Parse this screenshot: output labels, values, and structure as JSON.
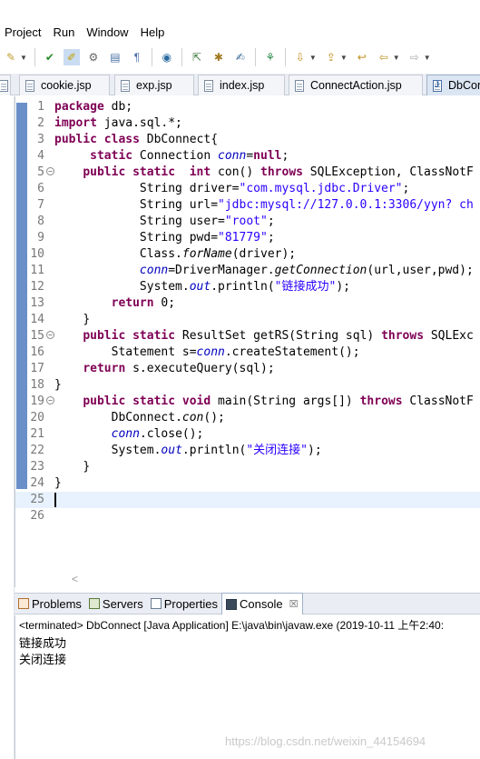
{
  "menu": [
    "Project",
    "Run",
    "Window",
    "Help"
  ],
  "toolbar_icons": [
    "pencil-icon",
    "skip-icon",
    "brush-icon",
    "gear-run-icon",
    "square-icon",
    "pilcrow-icon",
    "globe-icon",
    "task-icon",
    "puzzle-icon",
    "edit-icon",
    "git-icon",
    "down-arrow-icon",
    "wrench-icon",
    "back-icon",
    "back-arrow-icon",
    "forward-arrow-icon"
  ],
  "editor_tabs": [
    {
      "label": "cookie.jsp",
      "active": false
    },
    {
      "label": "exp.jsp",
      "active": false
    },
    {
      "label": "index.jsp",
      "active": false
    },
    {
      "label": "ConnectAction.jsp",
      "active": false
    },
    {
      "label": "DbCon",
      "active": true
    }
  ],
  "code_lines": [
    {
      "n": "1",
      "fold": false
    },
    {
      "n": "2",
      "fold": false
    },
    {
      "n": "3",
      "fold": false
    },
    {
      "n": "4",
      "fold": false
    },
    {
      "n": "5",
      "fold": true
    },
    {
      "n": "6",
      "fold": false
    },
    {
      "n": "7",
      "fold": false
    },
    {
      "n": "8",
      "fold": false
    },
    {
      "n": "9",
      "fold": false
    },
    {
      "n": "10",
      "fold": false
    },
    {
      "n": "11",
      "fold": false
    },
    {
      "n": "12",
      "fold": false
    },
    {
      "n": "13",
      "fold": false
    },
    {
      "n": "14",
      "fold": false
    },
    {
      "n": "15",
      "fold": true
    },
    {
      "n": "16",
      "fold": false
    },
    {
      "n": "17",
      "fold": false
    },
    {
      "n": "18",
      "fold": false
    },
    {
      "n": "19",
      "fold": true
    },
    {
      "n": "20",
      "fold": false
    },
    {
      "n": "21",
      "fold": false
    },
    {
      "n": "22",
      "fold": false
    },
    {
      "n": "23",
      "fold": false
    },
    {
      "n": "24",
      "fold": false
    },
    {
      "n": "25",
      "fold": false
    },
    {
      "n": "26",
      "fold": false
    }
  ],
  "code": {
    "l1_kw": "package",
    "l1_rest": " db;",
    "l2_kw": "import",
    "l2_rest": " java.sql.*;",
    "l3_kw1": "public",
    "l3_kw2": "class",
    "l3_rest": " DbConnect{",
    "l4_kw": "static",
    "l4_a": " Connection ",
    "l4_field": "conn",
    "l4_b": "=",
    "l4_kw2": "null",
    "l4_c": ";",
    "l5_kw1": "public",
    "l5_kw2": "static",
    "l5_kw3": "int",
    "l5_a": " con() ",
    "l5_kw4": "throws",
    "l5_b": " SQLException, ClassNotF",
    "l6_a": "String driver=",
    "l6_str": "\"com.mysql.jdbc.Driver\"",
    "l6_b": ";",
    "l7_a": "String url=",
    "l7_str": "\"jdbc:mysql://127.0.0.1:3306/yyn? ch",
    "l8_a": "String user=",
    "l8_str": "\"root\"",
    "l8_b": ";",
    "l9_a": "String pwd=",
    "l9_str": "\"81779\"",
    "l9_b": ";",
    "l10_a": "Class.",
    "l10_it": "forName",
    "l10_b": "(driver);",
    "l11_field": "conn",
    "l11_a": "=DriverManager.",
    "l11_it": "getConnection",
    "l11_b": "(url,user,pwd);",
    "l12_a": "System.",
    "l12_field": "out",
    "l12_b": ".println(",
    "l12_str": "\"链接成功\"",
    "l12_c": ");",
    "l13_kw": "return",
    "l13_a": " 0;",
    "l14_a": "}",
    "l15_kw1": "public",
    "l15_kw2": "static",
    "l15_a": " ResultSet getRS(String sql) ",
    "l15_kw3": "throws",
    "l15_b": " SQLExc",
    "l16_a": "Statement s=",
    "l16_field": "conn",
    "l16_b": ".createStatement();",
    "l17_kw": "return",
    "l17_a": " s.executeQuery(sql);",
    "l18_a": "}",
    "l19_kw1": "public",
    "l19_kw2": "static",
    "l19_kw3": "void",
    "l19_a": " main(String args[]) ",
    "l19_kw4": "throws",
    "l19_b": " ClassNotF",
    "l20_a": "DbConnect.",
    "l20_it": "con",
    "l20_b": "();",
    "l21_field": "conn",
    "l21_a": ".close();",
    "l22_a": "System.",
    "l22_field": "out",
    "l22_b": ".println(",
    "l22_str": "\"关闭连接\"",
    "l22_c": ");",
    "l23_a": "}",
    "l24_a": "}"
  },
  "bottom_tabs": [
    {
      "label": "Problems",
      "active": false
    },
    {
      "label": "Servers",
      "active": false
    },
    {
      "label": "Properties",
      "active": false
    },
    {
      "label": "Console",
      "active": true,
      "close": "☒"
    }
  ],
  "console": {
    "status": "<terminated> DbConnect [Java Application] E:\\java\\bin\\javaw.exe (2019-10-11 上午2:40:",
    "output": [
      "链接成功",
      "关闭连接"
    ]
  },
  "scroll_marker": "<",
  "watermark": "https://blog.csdn.net/weixin_44154694"
}
